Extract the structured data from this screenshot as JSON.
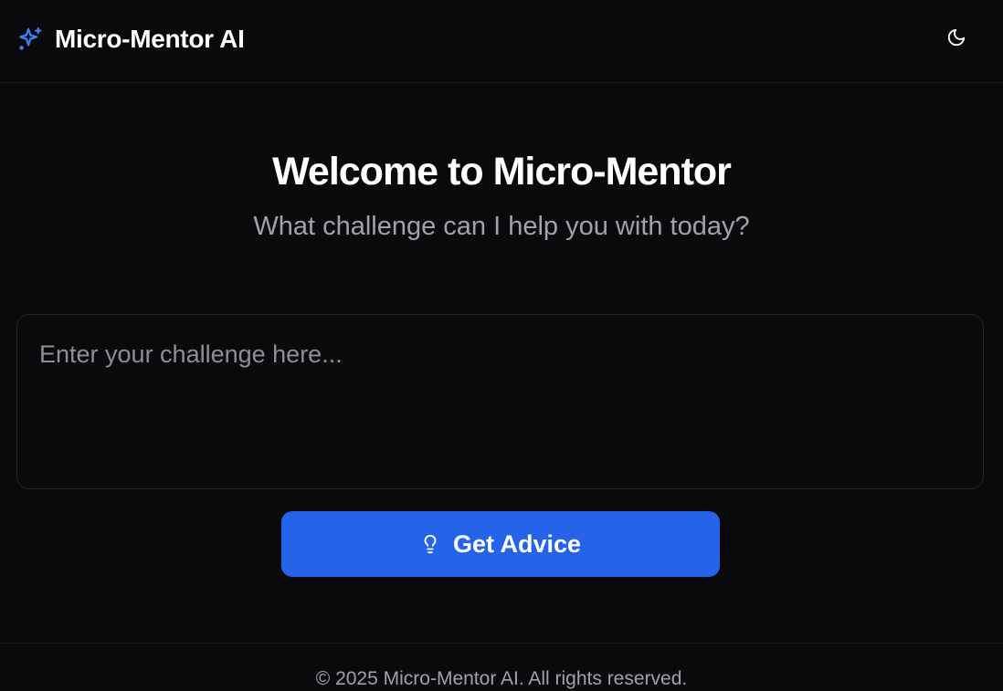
{
  "header": {
    "title": "Micro-Mentor AI",
    "brand_icon": "sparkles-icon",
    "theme_toggle_icon": "moon-icon"
  },
  "hero": {
    "title": "Welcome to Micro-Mentor",
    "subtitle": "What challenge can I help you with today?"
  },
  "challenge": {
    "value": "",
    "placeholder": "Enter your challenge here..."
  },
  "submit": {
    "label": "Get Advice",
    "icon": "lightbulb-icon"
  },
  "footer": {
    "copyright": "© 2025 Micro-Mentor AI. All rights reserved."
  },
  "colors": {
    "background": "#0a0a0c",
    "accent": "#2563eb",
    "brand_icon": "#3b82f6",
    "muted_text": "#a1a1aa",
    "border": "#26262a"
  }
}
